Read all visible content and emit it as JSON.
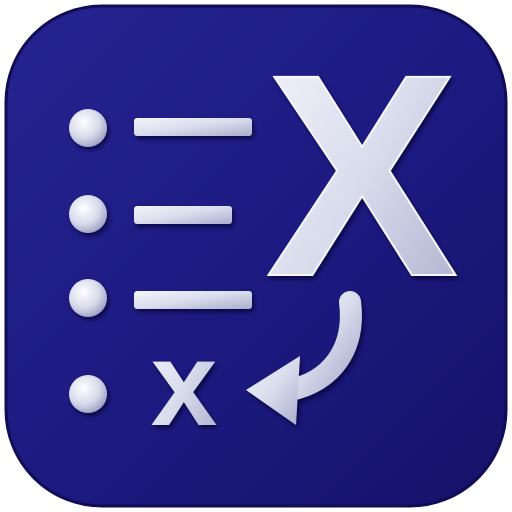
{
  "icon": {
    "big_letter": "X",
    "small_letter": "x",
    "colors": {
      "background": "#1c1a80",
      "background_edge": "#121060",
      "foreground": "#e4e6f2",
      "foreground_shadow": "#8e92b8"
    },
    "list_rows": 4,
    "arrow_icon": "curved-arrow-left-icon"
  }
}
